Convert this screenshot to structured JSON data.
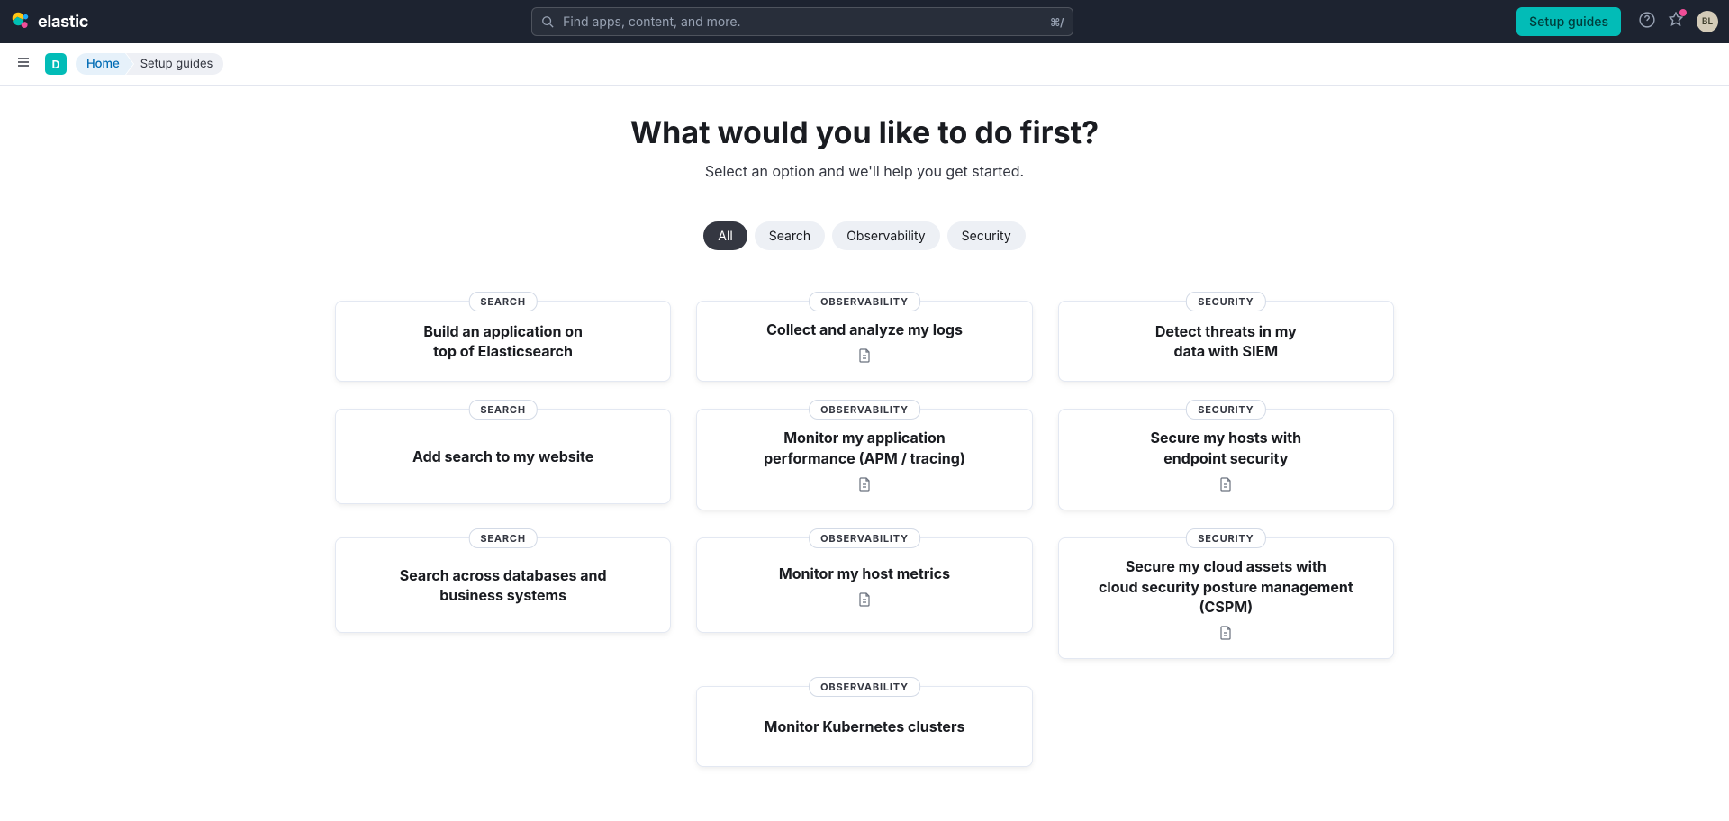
{
  "header": {
    "brand_text": "elastic",
    "search_placeholder": "Find apps, content, and more.",
    "kbd_shortcut": "⌘/",
    "setup_button": "Setup guides",
    "avatar_initials": "BL"
  },
  "subheader": {
    "space_initial": "D",
    "breadcrumb_home": "Home",
    "breadcrumb_current": "Setup guides"
  },
  "hero": {
    "title": "What would you like to do first?",
    "subtitle": "Select an option and we'll help you get started."
  },
  "filters": [
    {
      "label": "All",
      "active": true
    },
    {
      "label": "Search",
      "active": false
    },
    {
      "label": "Observability",
      "active": false
    },
    {
      "label": "Security",
      "active": false
    }
  ],
  "tags": {
    "search": "SEARCH",
    "observability": "OBSERVABILITY",
    "security": "SECURITY"
  },
  "cards": {
    "r0c0": "Build an application on\ntop of Elasticsearch",
    "r0c1": "Collect and analyze my logs",
    "r0c2": "Detect threats in my\ndata with SIEM",
    "r1c0": "Add search to my website",
    "r1c1": "Monitor my application\nperformance (APM / tracing)",
    "r1c2": "Secure my hosts with\nendpoint security",
    "r2c0": "Search across databases and\nbusiness systems",
    "r2c1": "Monitor my host metrics",
    "r2c2": "Secure my cloud assets with\ncloud security posture management (CSPM)",
    "r3c1": "Monitor Kubernetes clusters"
  }
}
